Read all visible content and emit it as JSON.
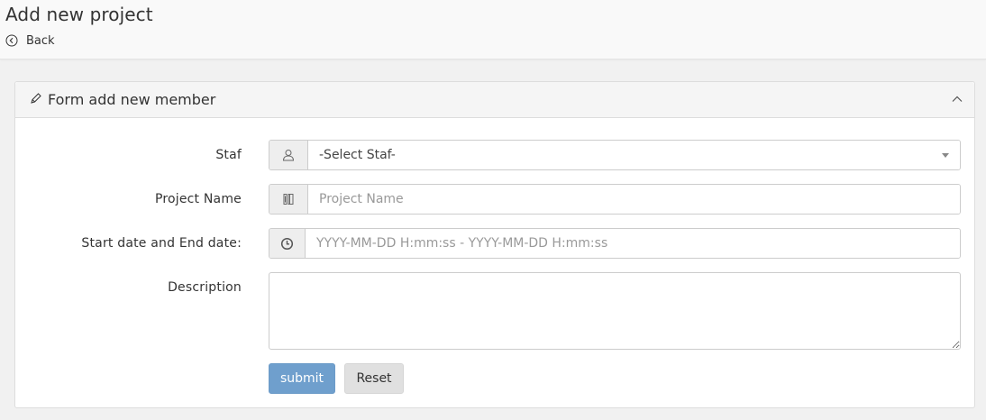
{
  "header": {
    "title": "Add new project",
    "back_label": "Back"
  },
  "panel": {
    "title": "Form add new member"
  },
  "form": {
    "staf": {
      "label": "Staf",
      "selected": "-Select Staf-"
    },
    "project_name": {
      "label": "Project Name",
      "placeholder": "Project Name",
      "value": ""
    },
    "date_range": {
      "label": "Start date and End date:",
      "placeholder": "YYYY-MM-DD H:mm:ss - YYYY-MM-DD H:mm:ss",
      "value": ""
    },
    "description": {
      "label": "Description",
      "value": ""
    },
    "submit_label": "submit",
    "reset_label": "Reset"
  },
  "icons": {
    "back": "circle-chevron-left-icon",
    "panel": "pencil-icon",
    "collapse": "chevron-up-icon",
    "staf": "user-icon",
    "project_name": "notebook-icon",
    "date_range": "clock-icon"
  },
  "colors": {
    "submit_bg": "#6f9fcd",
    "reset_bg": "#e0e0e0",
    "addon_bg": "#eeeeee",
    "panel_heading_bg": "#f5f5f5"
  }
}
